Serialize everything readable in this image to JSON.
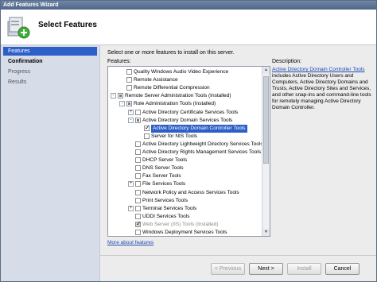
{
  "window": {
    "title": "Add Features Wizard"
  },
  "header": {
    "title": "Select Features",
    "icon": "features-add-icon"
  },
  "sidebar": {
    "items": [
      {
        "label": "Features",
        "state": "active"
      },
      {
        "label": "Confirmation",
        "state": "bold"
      },
      {
        "label": "Progress",
        "state": "normal"
      },
      {
        "label": "Results",
        "state": "normal"
      }
    ]
  },
  "main": {
    "intro": "Select one or more features to install on this server.",
    "features_label": "Features:",
    "description_label": "Description:",
    "tree": [
      {
        "label": "Quality Windows Audio Video Experience",
        "level": 1,
        "expander": "",
        "check": "none",
        "state": "normal"
      },
      {
        "label": "Remote Assistance",
        "level": 1,
        "expander": "",
        "check": "none",
        "state": "normal"
      },
      {
        "label": "Remote Differential Compression",
        "level": 1,
        "expander": "",
        "check": "none",
        "state": "normal"
      },
      {
        "label": "Remote Server Administration Tools  (Installed)",
        "level": 0,
        "expander": "-",
        "check": "partial",
        "state": "normal"
      },
      {
        "label": "Role Administration Tools  (Installed)",
        "level": 1,
        "expander": "-",
        "check": "partial",
        "state": "normal"
      },
      {
        "label": "Active Directory Certificate Services Tools",
        "level": 2,
        "expander": "+",
        "check": "none",
        "state": "normal"
      },
      {
        "label": "Active Directory Domain Services Tools",
        "level": 2,
        "expander": "-",
        "check": "partial",
        "state": "normal"
      },
      {
        "label": "Active Directory Domain Controller Tools",
        "level": 3,
        "expander": "",
        "check": "checked",
        "state": "selected"
      },
      {
        "label": "Server for NIS Tools",
        "level": 3,
        "expander": "",
        "check": "none",
        "state": "normal"
      },
      {
        "label": "Active Directory Lightweight Directory Services Tools",
        "level": 2,
        "expander": "",
        "check": "none",
        "state": "normal"
      },
      {
        "label": "Active Directory Rights Management Services Tools",
        "level": 2,
        "expander": "",
        "check": "none",
        "state": "normal"
      },
      {
        "label": "DHCP Server Tools",
        "level": 2,
        "expander": "",
        "check": "none",
        "state": "normal"
      },
      {
        "label": "DNS Server Tools",
        "level": 2,
        "expander": "",
        "check": "none",
        "state": "normal"
      },
      {
        "label": "Fax Server Tools",
        "level": 2,
        "expander": "",
        "check": "none",
        "state": "normal"
      },
      {
        "label": "File Services Tools",
        "level": 2,
        "expander": "+",
        "check": "none",
        "state": "normal"
      },
      {
        "label": "Network Policy and Access Services Tools",
        "level": 2,
        "expander": "",
        "check": "none",
        "state": "normal"
      },
      {
        "label": "Print Services Tools",
        "level": 2,
        "expander": "",
        "check": "none",
        "state": "normal"
      },
      {
        "label": "Terminal Services Tools",
        "level": 2,
        "expander": "+",
        "check": "none",
        "state": "normal"
      },
      {
        "label": "UDDI Services Tools",
        "level": 2,
        "expander": "",
        "check": "none",
        "state": "normal"
      },
      {
        "label": "Web Server (IIS) Tools  (Installed)",
        "level": 2,
        "expander": "",
        "check": "checked-grey",
        "state": "disabled"
      },
      {
        "label": "Windows Deployment Services Tools",
        "level": 2,
        "expander": "",
        "check": "none",
        "state": "normal"
      }
    ],
    "description": {
      "link": "Active Directory Domain Controller Tools",
      "text": " includes Active Directory Users and Computers, Active Directory Domains and Trusts, Active Directory Sites and Services, and other snap-ins and command-line tools for remotely managing Active Directory Domain Controller."
    },
    "more_link": "More about features"
  },
  "footer": {
    "previous": "< Previous",
    "next": "Next >",
    "install": "Install",
    "cancel": "Cancel"
  },
  "colors": {
    "selection": "#2d5fc8",
    "link": "#1f49b4",
    "sidebar_bg": "#d6dce8"
  }
}
